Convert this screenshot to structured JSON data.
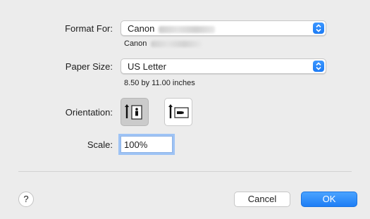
{
  "format_for": {
    "label": "Format For:",
    "value": "Canon",
    "sub_text": "Canon"
  },
  "paper_size": {
    "label": "Paper Size:",
    "value": "US Letter",
    "sub_text": "8.50 by 11.00 inches"
  },
  "orientation": {
    "label": "Orientation:",
    "options": [
      "portrait",
      "landscape"
    ],
    "selected": "portrait"
  },
  "scale": {
    "label": "Scale:",
    "value": "100%"
  },
  "buttons": {
    "help": "?",
    "cancel": "Cancel",
    "ok": "OK"
  },
  "colors": {
    "accent": "#1e7ef5",
    "background": "#ececec"
  }
}
